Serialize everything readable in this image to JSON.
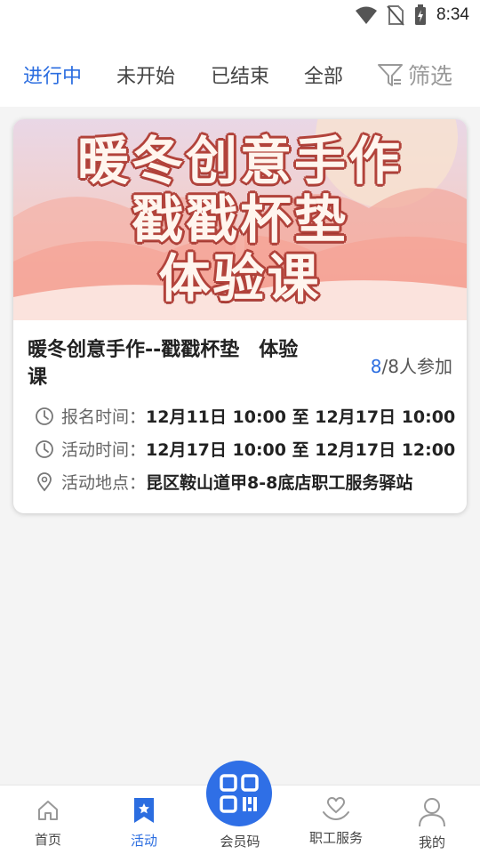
{
  "status_bar": {
    "time": "8:34"
  },
  "tabs": [
    {
      "label": "进行中",
      "active": true
    },
    {
      "label": "未开始",
      "active": false
    },
    {
      "label": "已结束",
      "active": false
    },
    {
      "label": "全部",
      "active": false
    }
  ],
  "filter_label": "筛选",
  "activity": {
    "banner_lines": [
      "暖冬创意手作",
      "戳戳杯垫",
      "体验课"
    ],
    "title_line1": "暖冬创意手作--戳戳杯垫　体验",
    "title_line2": "课",
    "joined": "8",
    "capacity_text": "/8人参加",
    "signup_label": "报名时间：",
    "signup_value": "12月11日 10:00 至 12月17日 10:00",
    "event_label": "活动时间：",
    "event_value": "12月17日 10:00 至 12月17日 12:00",
    "location_label": "活动地点：",
    "location_value": "昆区鞍山道甲8-8底店职工服务驿站"
  },
  "bottom_nav": [
    {
      "label": "首页",
      "icon": "home-icon",
      "active": false
    },
    {
      "label": "活动",
      "icon": "bookmark-star-icon",
      "active": true
    },
    {
      "label": "会员码",
      "icon": "qr-code-icon",
      "active": false
    },
    {
      "label": "职工服务",
      "icon": "heart-hand-icon",
      "active": false
    },
    {
      "label": "我的",
      "icon": "person-icon",
      "active": false
    }
  ],
  "colors": {
    "accent": "#2b6de0",
    "banner_pink": "#f6c7c0",
    "title_red": "#b2433b"
  }
}
